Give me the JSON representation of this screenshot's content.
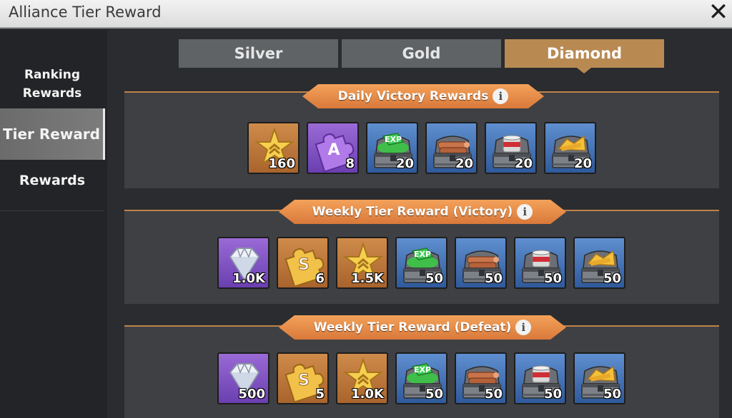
{
  "window": {
    "title": "Alliance Tier Reward",
    "close_icon": "close-icon"
  },
  "sidebar": {
    "items": [
      {
        "label": "Ranking Rewards",
        "selected": false
      },
      {
        "label": "Tier Reward",
        "selected": true
      },
      {
        "label": "Rewards",
        "selected": false
      }
    ]
  },
  "tabs": [
    {
      "label": "Silver",
      "selected": false
    },
    {
      "label": "Gold",
      "selected": false
    },
    {
      "label": "Diamond",
      "selected": true
    }
  ],
  "sections": [
    {
      "title": "Daily Victory Rewards",
      "info_icon": "info-icon",
      "items": [
        {
          "icon": "gold-badge-icon",
          "qty": "160",
          "rarity": "orange"
        },
        {
          "icon": "purple-puzzle-a-icon",
          "qty": "8",
          "rarity": "purple"
        },
        {
          "icon": "exp-chest-icon",
          "qty": "20",
          "rarity": "blue"
        },
        {
          "icon": "wood-chest-icon",
          "qty": "20",
          "rarity": "blue"
        },
        {
          "icon": "food-chest-icon",
          "qty": "20",
          "rarity": "blue"
        },
        {
          "icon": "gold-chest-icon",
          "qty": "20",
          "rarity": "blue"
        }
      ]
    },
    {
      "title": "Weekly Tier Reward (Victory)",
      "info_icon": "info-icon",
      "items": [
        {
          "icon": "diamond-icon",
          "qty": "1.0K",
          "rarity": "purple"
        },
        {
          "icon": "gold-puzzle-s-icon",
          "qty": "6",
          "rarity": "orange"
        },
        {
          "icon": "gold-badge-icon",
          "qty": "1.5K",
          "rarity": "orange"
        },
        {
          "icon": "exp-chest-icon",
          "qty": "50",
          "rarity": "blue"
        },
        {
          "icon": "wood-chest-icon",
          "qty": "50",
          "rarity": "blue"
        },
        {
          "icon": "food-chest-icon",
          "qty": "50",
          "rarity": "blue"
        },
        {
          "icon": "gold-chest-icon",
          "qty": "50",
          "rarity": "blue"
        }
      ]
    },
    {
      "title": "Weekly Tier Reward (Defeat)",
      "info_icon": "info-icon",
      "items": [
        {
          "icon": "diamond-icon",
          "qty": "500",
          "rarity": "purple"
        },
        {
          "icon": "gold-puzzle-s-icon",
          "qty": "5",
          "rarity": "orange"
        },
        {
          "icon": "gold-badge-icon",
          "qty": "1.0K",
          "rarity": "orange"
        },
        {
          "icon": "exp-chest-icon",
          "qty": "50",
          "rarity": "blue"
        },
        {
          "icon": "wood-chest-icon",
          "qty": "50",
          "rarity": "blue"
        },
        {
          "icon": "food-chest-icon",
          "qty": "50",
          "rarity": "blue"
        },
        {
          "icon": "gold-chest-icon",
          "qty": "50",
          "rarity": "blue"
        }
      ]
    }
  ],
  "colors": {
    "accent": "#d9793a",
    "selected_tab": "#b88a52",
    "panel": "#3f4044"
  },
  "badges": {
    "exp": "EXP",
    "puzzle_a": "A",
    "puzzle_s": "S"
  }
}
